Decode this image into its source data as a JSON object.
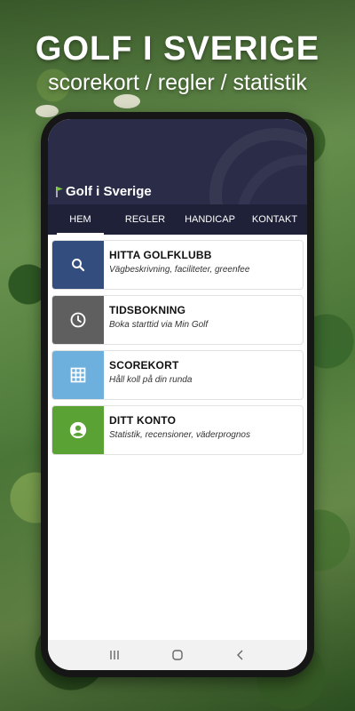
{
  "promo": {
    "title": "GOLF I SVERIGE",
    "subtitle": "scorekort / regler / statistik"
  },
  "app": {
    "logo_text": "Golf i Sverige",
    "header_color": "#2a2c48",
    "nav_color": "#1f2138"
  },
  "nav": {
    "tabs": [
      {
        "label": "HEM",
        "active": true
      },
      {
        "label": "REGLER",
        "active": false
      },
      {
        "label": "HANDICAP",
        "active": false
      },
      {
        "label": "KONTAKT",
        "active": false
      }
    ]
  },
  "cards": [
    {
      "title": "HITTA GOLFKLUBB",
      "subtitle": "Vägbeskrivning, faciliteter, greenfee",
      "icon": "search-icon",
      "color": "#344d7f"
    },
    {
      "title": "TIDSBOKNING",
      "subtitle": "Boka starttid via Min Golf",
      "icon": "clock-icon",
      "color": "#5f5f5f"
    },
    {
      "title": "SCOREKORT",
      "subtitle": "Håll koll på din runda",
      "icon": "grid-icon",
      "color": "#6eb0dd"
    },
    {
      "title": "DITT KONTO",
      "subtitle": "Statistik, recensioner, väderprognos",
      "icon": "account-icon",
      "color": "#5ba235"
    }
  ],
  "system_nav": {
    "buttons": [
      "recents-icon",
      "home-icon",
      "back-icon"
    ]
  }
}
